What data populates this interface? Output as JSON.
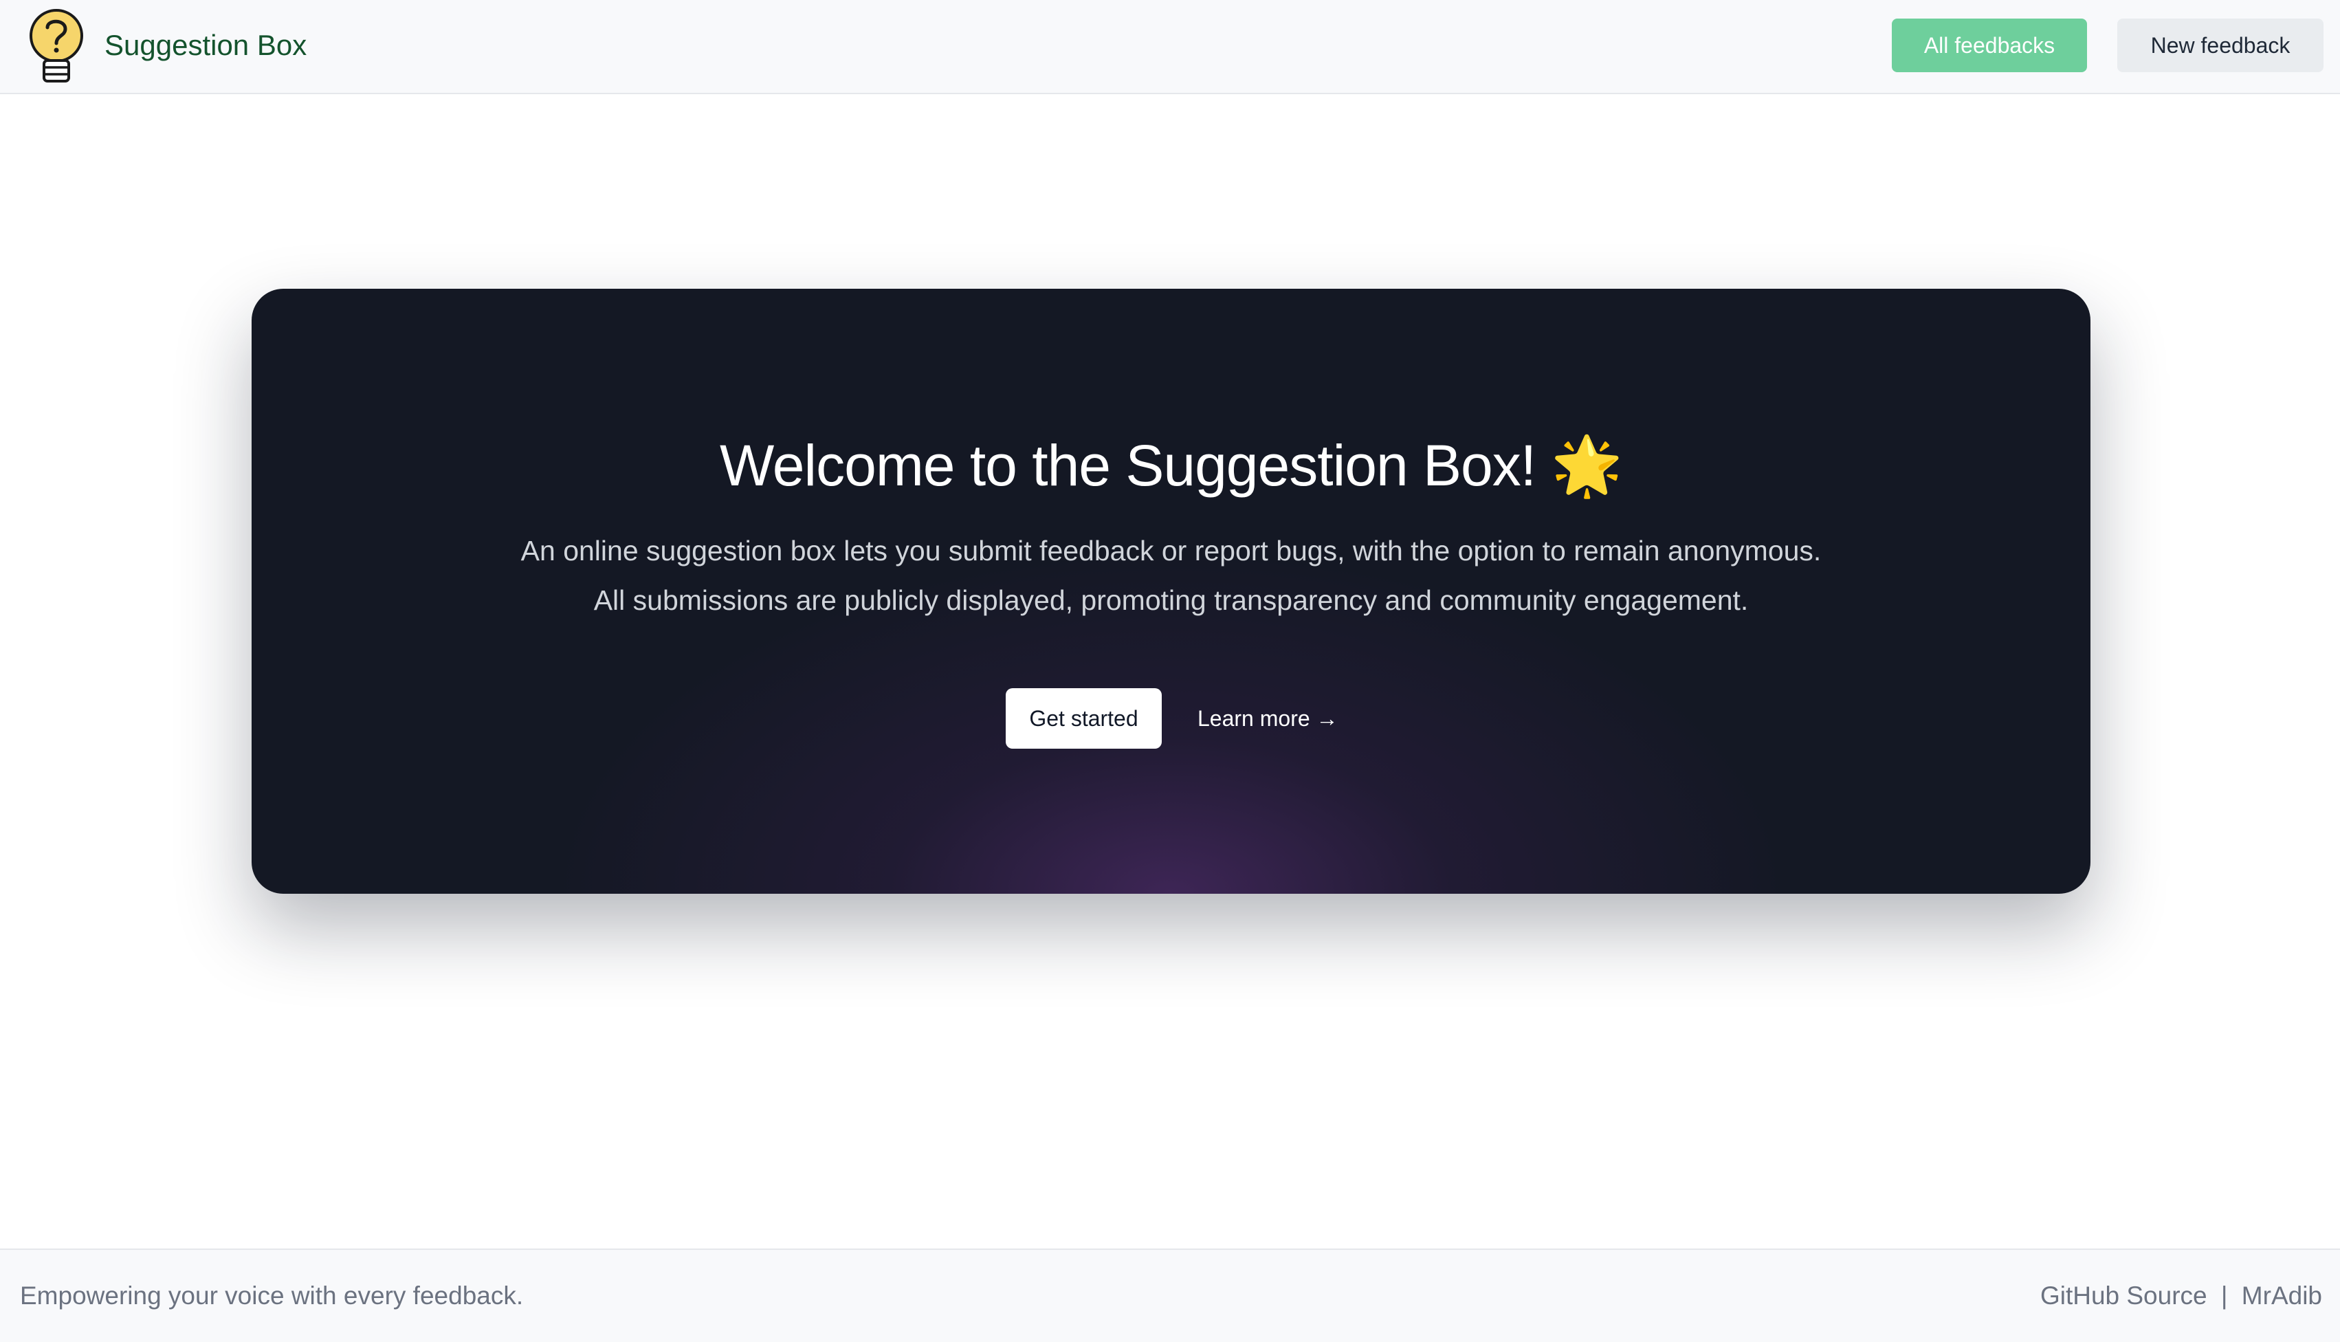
{
  "header": {
    "logo_icon": "lightbulb-question-icon",
    "brand": "Suggestion Box",
    "nav": {
      "all_feedbacks": "All feedbacks",
      "new_feedback": "New feedback"
    }
  },
  "hero": {
    "title": "Welcome to the Suggestion Box! 🌟",
    "description_line1": "An online suggestion box lets you submit feedback or report bugs, with the option to remain anonymous.",
    "description_line2": "All submissions are publicly displayed, promoting transparency and community engagement.",
    "cta_primary": "Get started",
    "cta_secondary": "Learn more →"
  },
  "footer": {
    "tagline": "Empowering your voice with every feedback.",
    "link_github": "GitHub Source",
    "separator": "|",
    "link_author": "MrAdib"
  },
  "colors": {
    "brand_text": "#14532d",
    "primary_button": "#6ecf9c",
    "secondary_button": "#e9ecef",
    "hero_background": "#141824",
    "hero_glow": "#7c3aa0",
    "footer_text": "#6b7280"
  }
}
